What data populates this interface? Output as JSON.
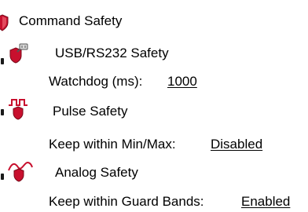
{
  "tree": {
    "root": {
      "label": "Command Safety",
      "icon": "shield-icon"
    },
    "items": [
      {
        "label": "USB/RS232 Safety",
        "icon": "usb-plug-shield-icon",
        "property": {
          "name": "Watchdog (ms):",
          "value": "1000"
        }
      },
      {
        "label": "Pulse Safety",
        "icon": "pulse-shield-icon",
        "property": {
          "name": "Keep within Min/Max:",
          "value": "Disabled"
        }
      },
      {
        "label": "Analog Safety",
        "icon": "analog-wave-shield-icon",
        "property": {
          "name": "Keep within Guard Bands:",
          "value": "Enabled"
        }
      }
    ]
  },
  "colors": {
    "shield_red": "#c8102e",
    "shield_dark": "#7a0a1a",
    "link_text": "#000000"
  }
}
